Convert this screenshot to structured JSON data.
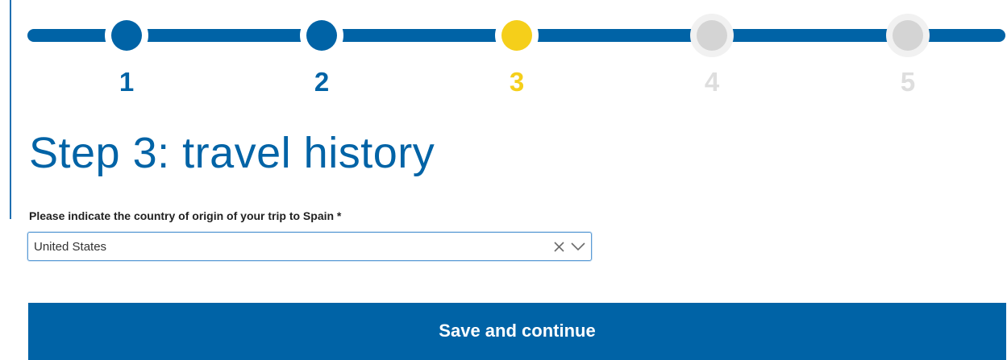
{
  "stepper": {
    "steps": [
      {
        "number": "1",
        "state": "completed"
      },
      {
        "number": "2",
        "state": "completed"
      },
      {
        "number": "3",
        "state": "current"
      },
      {
        "number": "4",
        "state": "upcoming"
      },
      {
        "number": "5",
        "state": "upcoming"
      }
    ],
    "colors": {
      "completed": "#0063a6",
      "current": "#f5cf1a",
      "upcoming": "#d4d4d4"
    }
  },
  "page": {
    "title": "Step 3: travel history"
  },
  "origin_field": {
    "label": "Please indicate the country of origin of your trip to Spain *",
    "value": "United States",
    "clear_icon": "close-icon",
    "dropdown_icon": "chevron-down-icon"
  },
  "actions": {
    "save_label": "Save and continue"
  }
}
